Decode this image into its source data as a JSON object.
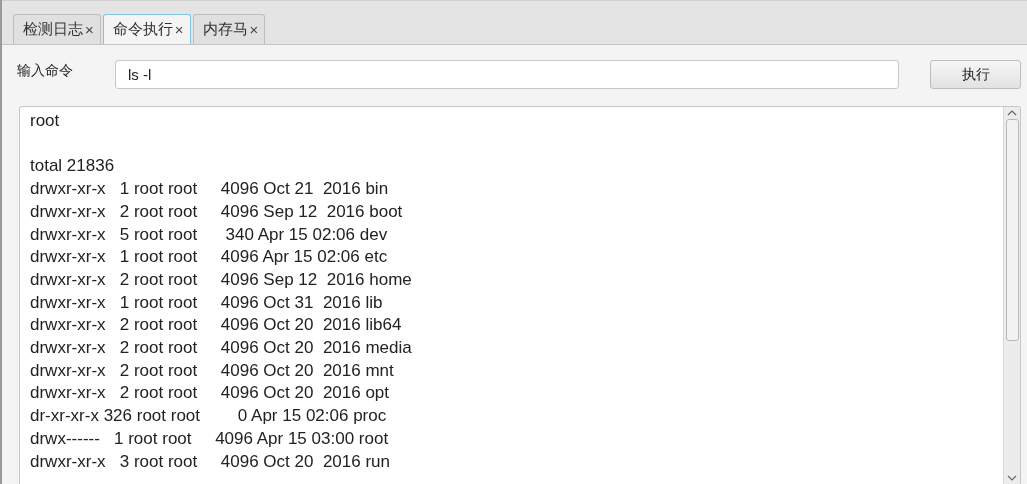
{
  "tabs": [
    {
      "label": "检测日志",
      "close": "×",
      "selected": false
    },
    {
      "label": "命令执行",
      "close": "×",
      "selected": true
    },
    {
      "label": "内存马",
      "close": "×",
      "selected": false
    }
  ],
  "command": {
    "label": "输入命令",
    "value": "ls -l",
    "button": "执行"
  },
  "output": {
    "header": "root",
    "lines": [
      "total 21836",
      "drwxr-xr-x   1 root root     4096 Oct 21  2016 bin",
      "drwxr-xr-x   2 root root     4096 Sep 12  2016 boot",
      "drwxr-xr-x   5 root root      340 Apr 15 02:06 dev",
      "drwxr-xr-x   1 root root     4096 Apr 15 02:06 etc",
      "drwxr-xr-x   2 root root     4096 Sep 12  2016 home",
      "drwxr-xr-x   1 root root     4096 Oct 31  2016 lib",
      "drwxr-xr-x   2 root root     4096 Oct 20  2016 lib64",
      "drwxr-xr-x   2 root root     4096 Oct 20  2016 media",
      "drwxr-xr-x   2 root root     4096 Oct 20  2016 mnt",
      "drwxr-xr-x   2 root root     4096 Oct 20  2016 opt",
      "dr-xr-xr-x 326 root root        0 Apr 15 02:06 proc",
      "drwx------   1 root root     4096 Apr 15 03:00 root",
      "drwxr-xr-x   3 root root     4096 Oct 20  2016 run"
    ]
  }
}
